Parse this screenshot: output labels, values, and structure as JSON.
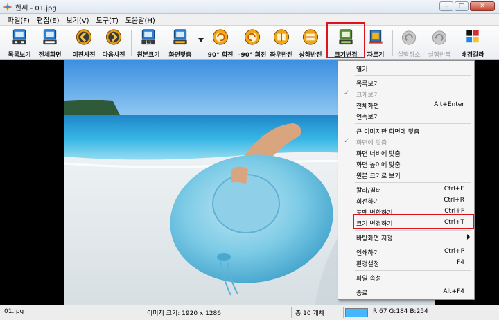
{
  "window": {
    "title": "한씨 - 01.jpg",
    "controls": {
      "minimize": "–",
      "maximize": "□",
      "close": "✕"
    }
  },
  "menu": [
    "파일(F)",
    "편집(E)",
    "보기(V)",
    "도구(T)",
    "도움말(H)"
  ],
  "toolbar": {
    "list_view": "목록보기",
    "full_screen": "전체화면",
    "prev_photo": "이전사진",
    "next_photo": "다음사진",
    "original_size": "원본크기",
    "fit_screen": "화면맞춤",
    "rotate_90": "90° 회전",
    "rotate_neg90": "-90° 회전",
    "flip_lr": "좌우반전",
    "flip_ud": "상하반전",
    "resize": "크기변경",
    "crop": "자르기",
    "undo": "실행취소",
    "redo": "실행반복",
    "bg_color": "배경칼라"
  },
  "context_menu": {
    "open": "열기",
    "list_view": "목록보기",
    "large_view": "크게보기",
    "full_screen": {
      "label": "전체화면",
      "shortcut": "Alt+Enter"
    },
    "slideshow": "연속보기",
    "fit_large": "큰 이미지만 화면에 맞춤",
    "fit_screen": "화면에 맞춤",
    "fit_width": "화면 너비에 맞춤",
    "fit_height": "화면 높이에 맞춤",
    "original_size": "원본 크기로 보기",
    "color_filter": {
      "label": "칼라/필터",
      "shortcut": "Ctrl+E"
    },
    "rotate": {
      "label": "회전하기",
      "shortcut": "Ctrl+R"
    },
    "convert_format": {
      "label": "포맷 변환하기",
      "shortcut": "Ctrl+F"
    },
    "resize": {
      "label": "크기 변경하기",
      "shortcut": "Ctrl+T"
    },
    "set_wallpaper": "바탕화면 지정",
    "print": {
      "label": "인쇄하기",
      "shortcut": "Ctrl+P"
    },
    "settings": {
      "label": "환경설정",
      "shortcut": "F4"
    },
    "file_props": "파일 속성",
    "exit": {
      "label": "종료",
      "shortcut": "Alt+F4"
    }
  },
  "status": {
    "filename": "01.jpg",
    "image_size": "이미지 크기: 1920 x 1286",
    "total": "총 10 개체",
    "pixel_color": "R:67 G:184 B:254",
    "swatch_color": "#43b8fe"
  }
}
